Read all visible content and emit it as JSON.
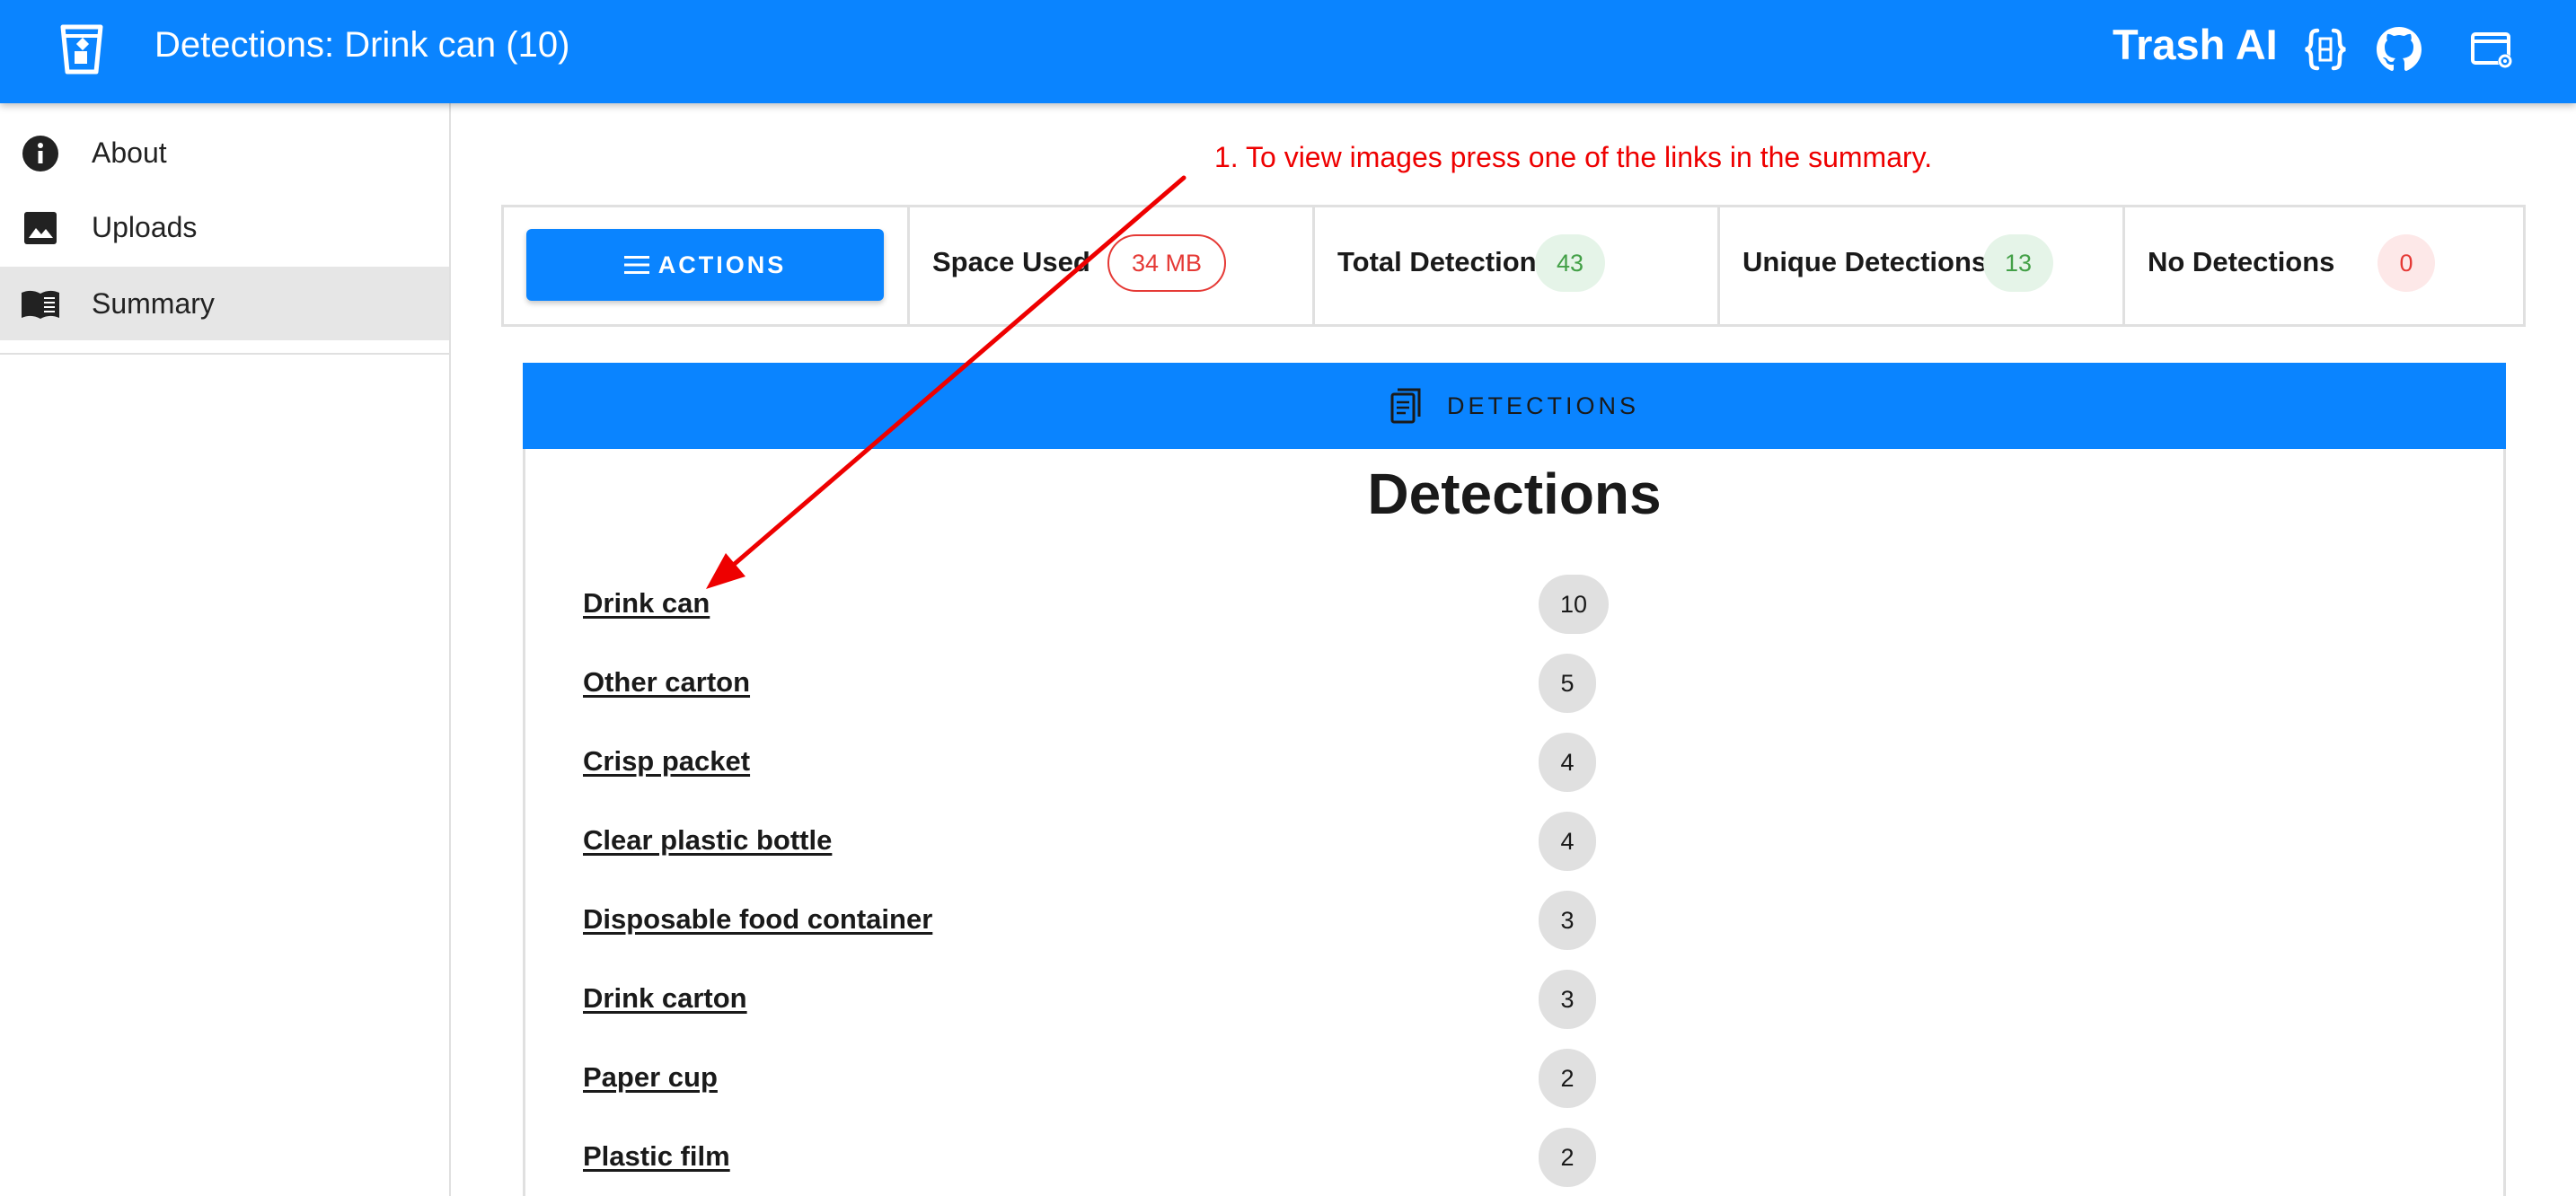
{
  "appbar": {
    "title": "Detections: Drink can (10)",
    "brand": "Trash AI",
    "color": "#0a84ff"
  },
  "icons": {
    "logo": "trash-bin-logo-icon",
    "api": "api-braces-icon",
    "github": "github-icon",
    "settings": "browser-settings-icon"
  },
  "sidebar": {
    "items": [
      {
        "label": "About",
        "icon": "info-icon",
        "active": false
      },
      {
        "label": "Uploads",
        "icon": "image-icon",
        "active": false
      },
      {
        "label": "Summary",
        "icon": "book-icon",
        "active": true
      }
    ]
  },
  "stats": {
    "actions_label": "ACTIONS",
    "space_used": {
      "label": "Space Used",
      "value": "34 MB"
    },
    "total_detections": {
      "label": "Total Detections",
      "value": "43"
    },
    "unique_detections": {
      "label": "Unique Detections",
      "value": "13"
    },
    "no_detections": {
      "label": "No Detections",
      "value": "0"
    }
  },
  "detections": {
    "header_label": "DETECTIONS",
    "title": "Detections",
    "rows": [
      {
        "name": "Drink can",
        "count": "10"
      },
      {
        "name": "Other carton",
        "count": "5"
      },
      {
        "name": "Crisp packet",
        "count": "4"
      },
      {
        "name": "Clear plastic bottle",
        "count": "4"
      },
      {
        "name": "Disposable food container",
        "count": "3"
      },
      {
        "name": "Drink carton",
        "count": "3"
      },
      {
        "name": "Paper cup",
        "count": "2"
      },
      {
        "name": "Plastic film",
        "count": "2"
      }
    ]
  },
  "annotation": {
    "text": "1. To view images press one of the links in the summary.",
    "color": "#ee0000"
  }
}
